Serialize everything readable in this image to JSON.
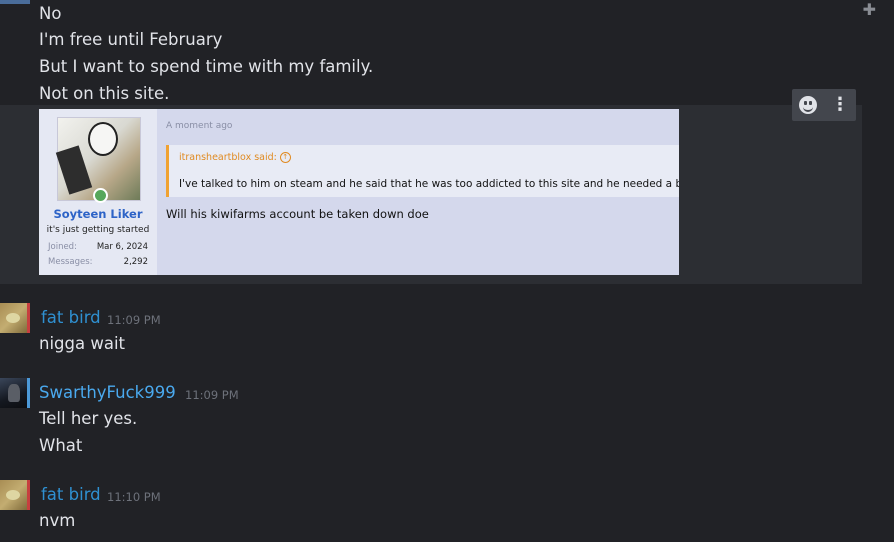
{
  "top_messages": [
    "No",
    "I'm free until February",
    "But I want to spend time with my family.",
    "Not on this site."
  ],
  "embedded_screenshot": {
    "time": "A moment ago",
    "user_name": "Soyteen Liker",
    "user_title": "it's just getting started",
    "joined_label": "Joined:",
    "joined_value": "Mar 6, 2024",
    "messages_label": "Messages:",
    "messages_value": "2,292",
    "quote_attribution": "itransheartblox said:",
    "quote_text": "I've talked to him on steam and he said that he was too addicted to this site and he needed a break",
    "body": "Will his kiwifarms account be taken down doe"
  },
  "groups": [
    {
      "username": "fat bird",
      "timestamp": "11:09 PM",
      "lines": [
        "nigga wait"
      ],
      "username_color": "#2f90d1"
    },
    {
      "username": "SwarthyFuck999",
      "timestamp": "11:09 PM",
      "lines": [
        "Tell her yes.",
        "What"
      ],
      "username_color": "#4aa9ee"
    },
    {
      "username": "fat bird",
      "timestamp": "11:10 PM",
      "lines": [
        "nvm"
      ],
      "username_color": "#2f90d1"
    }
  ],
  "icons": {
    "pin": "add-pin-icon",
    "emoji": "emoji-reaction-icon",
    "more": "more-options-icon"
  },
  "colors": {
    "background": "#212226",
    "text": "#e1e3e8",
    "timestamp": "#6d717a"
  }
}
